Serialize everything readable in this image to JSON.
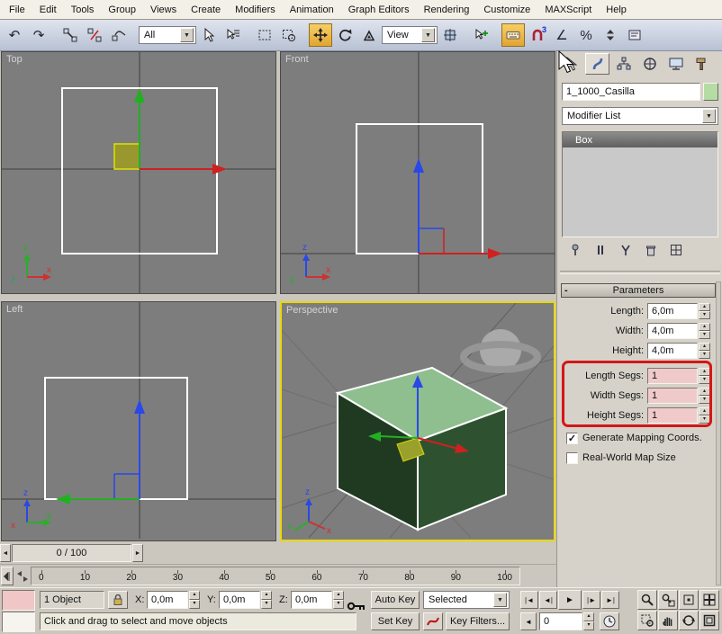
{
  "menubar": {
    "items": [
      "File",
      "Edit",
      "Tools",
      "Group",
      "Views",
      "Create",
      "Modifiers",
      "Animation",
      "Graph Editors",
      "Rendering",
      "Customize",
      "MAXScript",
      "Help"
    ]
  },
  "toolbar": {
    "selection_filter": "All",
    "reference_coordsys": "View"
  },
  "icons": {
    "undo": "↶",
    "redo": "↷",
    "combo_arrow": "▼",
    "spin_up": "▴",
    "spin_dn": "▾",
    "check": "✓",
    "slider_left": "◄",
    "slider_right": "►",
    "snap_badge": "3",
    "angle": "∠",
    "percent": "%",
    "minus": "-",
    "go_start": "|◄",
    "frame_back": "◄|",
    "play": "►",
    "frame_fwd": "|►",
    "go_end": "►|",
    "key_mode": "◄"
  },
  "viewports": {
    "top_label": "Top",
    "front_label": "Front",
    "left_label": "Left",
    "perspective_label": "Perspective",
    "axis_x": "x",
    "axis_y": "y",
    "axis_z": "z"
  },
  "command_panel": {
    "object_name": "1_1000_Casilla",
    "modifier_list": "Modifier List",
    "stack": [
      "Box"
    ],
    "parameters": {
      "title": "Parameters",
      "length_label": "Length:",
      "length_value": "6,0m",
      "width_label": "Width:",
      "width_value": "4,0m",
      "height_label": "Height:",
      "height_value": "4,0m",
      "length_segs_label": "Length Segs:",
      "length_segs_value": "1",
      "width_segs_label": "Width Segs:",
      "width_segs_value": "1",
      "height_segs_label": "Height Segs:",
      "height_segs_value": "1",
      "gen_mapping_label": "Generate Mapping Coords.",
      "real_world_label": "Real-World Map Size"
    }
  },
  "trackbar": {
    "range": "0 / 100"
  },
  "timeline": {
    "ticks": [
      "0",
      "10",
      "20",
      "30",
      "40",
      "50",
      "60",
      "70",
      "80",
      "90",
      "100"
    ]
  },
  "status_bar": {
    "object_count": "1 Object",
    "x_label": "X:",
    "x_value": "0,0m",
    "y_label": "Y:",
    "y_value": "0,0m",
    "z_label": "Z:",
    "z_value": "0,0m",
    "prompt": "Click and drag to select and move objects",
    "auto_key_label": "Auto Key",
    "set_key_label": "Set Key",
    "key_mode_dropdown": "Selected",
    "key_filters_label": "Key Filters...",
    "current_frame": "0"
  }
}
